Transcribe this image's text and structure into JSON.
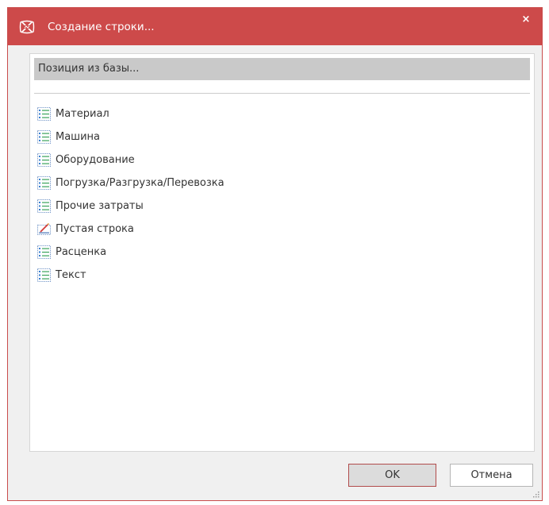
{
  "window": {
    "title": "Создание строки...",
    "close_glyph": "×",
    "accent_color": "#cd4a4a"
  },
  "base_position": {
    "label": "Позиция из базы..."
  },
  "items": [
    {
      "label": "Материал",
      "icon": "list-icon"
    },
    {
      "label": "Машина",
      "icon": "list-icon"
    },
    {
      "label": "Оборудование",
      "icon": "list-icon"
    },
    {
      "label": "Погрузка/Разгрузка/Перевозка",
      "icon": "list-icon"
    },
    {
      "label": "Прочие затраты",
      "icon": "list-icon"
    },
    {
      "label": "Пустая строка",
      "icon": "empty-row-icon"
    },
    {
      "label": "Расценка",
      "icon": "list-icon"
    },
    {
      "label": "Текст",
      "icon": "list-icon"
    }
  ],
  "buttons": {
    "ok_label": "OK",
    "cancel_label": "Отмена"
  }
}
